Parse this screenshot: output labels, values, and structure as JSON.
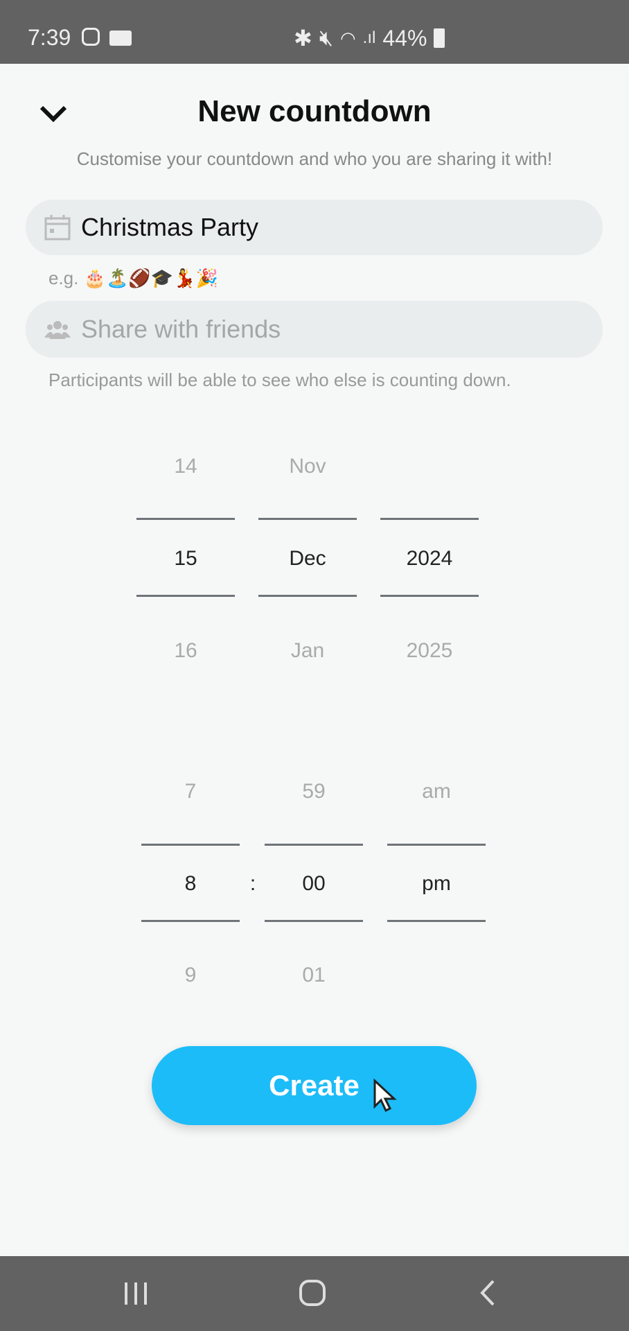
{
  "status_bar": {
    "time": "7:39",
    "battery": "44%",
    "icons": [
      "instagram-icon",
      "video-icon",
      "bluetooth-icon",
      "mute-icon",
      "wifi-icon",
      "signal-icon",
      "battery-icon"
    ]
  },
  "header": {
    "title": "New countdown",
    "subtitle": "Customise your countdown and who you are sharing it with!",
    "collapse_icon": "chevron-down-icon"
  },
  "name_field": {
    "value": "Christmas Party",
    "icon": "calendar-icon"
  },
  "examples": {
    "label": "e.g.",
    "emojis": "🎂🏝️🏈🎓💃🎉"
  },
  "share_field": {
    "placeholder": "Share with friends",
    "icon": "friends-icon"
  },
  "participants_note": "Participants will be able to see who else is counting down.",
  "date_picker": {
    "day": [
      "14",
      "15",
      "16"
    ],
    "month": [
      "Nov",
      "Dec",
      "Jan"
    ],
    "year": [
      "",
      "2024",
      "2025"
    ]
  },
  "time_picker": {
    "hour": [
      "7",
      "8",
      "9"
    ],
    "minute": [
      "59",
      "00",
      "01"
    ],
    "period": [
      "am",
      "pm",
      ""
    ],
    "separator": ":"
  },
  "create_label": "Create",
  "accent": "#1cbcf8"
}
